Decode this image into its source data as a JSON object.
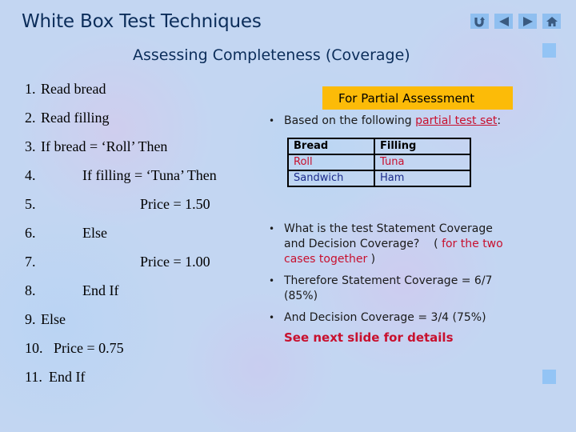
{
  "slide": {
    "title": "White Box Test Techniques",
    "subtitle": "Assessing Completeness (Coverage)"
  },
  "nav": {
    "buttons": [
      {
        "name": "return-icon",
        "label": "Return"
      },
      {
        "name": "previous-icon",
        "label": "Previous"
      },
      {
        "name": "next-icon",
        "label": "Next"
      },
      {
        "name": "home-icon",
        "label": "Home"
      }
    ],
    "accent_color": "#8fbff0",
    "icon_color": "#3a5a80"
  },
  "code": {
    "lines": [
      {
        "num": "1.",
        "text": "Read bread",
        "indent": 0
      },
      {
        "num": "2.",
        "text": "Read filling",
        "indent": 0
      },
      {
        "num": "3.",
        "text": "If bread = ‘Roll’ Then",
        "indent": 0
      },
      {
        "num": "4.",
        "text": "If filling = ‘Tuna’ Then",
        "indent": 1
      },
      {
        "num": "5.",
        "text": "Price = 1.50",
        "indent": 2
      },
      {
        "num": "6.",
        "text": "Else",
        "indent": 1
      },
      {
        "num": "7.",
        "text": "Price = 1.00",
        "indent": 2
      },
      {
        "num": "8.",
        "text": "End If",
        "indent": 1
      },
      {
        "num": "9.",
        "text": "Else",
        "indent": 0
      },
      {
        "num": "10.",
        "text": "Price = 0.75",
        "indent": 3
      },
      {
        "num": "11.",
        "text": "End If",
        "indent": 0
      }
    ]
  },
  "partial": {
    "banner": "For Partial Assessment",
    "banner_color": "#fcbb08",
    "bullet1_prefix": "Based on the following ",
    "bullet1_link": "partial test set",
    "bullet1_suffix": ":",
    "table": {
      "headers": [
        "Bread",
        "Filling"
      ],
      "rows": [
        [
          "Roll",
          "Tuna"
        ],
        [
          "Sandwich",
          "Ham"
        ]
      ]
    },
    "bullet2_line1": "What is the test Statement Coverage",
    "bullet2_line2_a": "and Decision Coverage?    ( ",
    "bullet2_line2_b": "for the two",
    "bullet2_line3_a": "cases together",
    "bullet2_line3_b": " )",
    "bullet3_line1": "Therefore Statement Coverage = 6/7",
    "bullet3_line2": "(85%)",
    "bullet4": "And Decision Coverage = 3/4 (75%)",
    "next_link": "See next slide for details",
    "highlight_color": "#c8102e"
  },
  "bullet_glyph": "•"
}
